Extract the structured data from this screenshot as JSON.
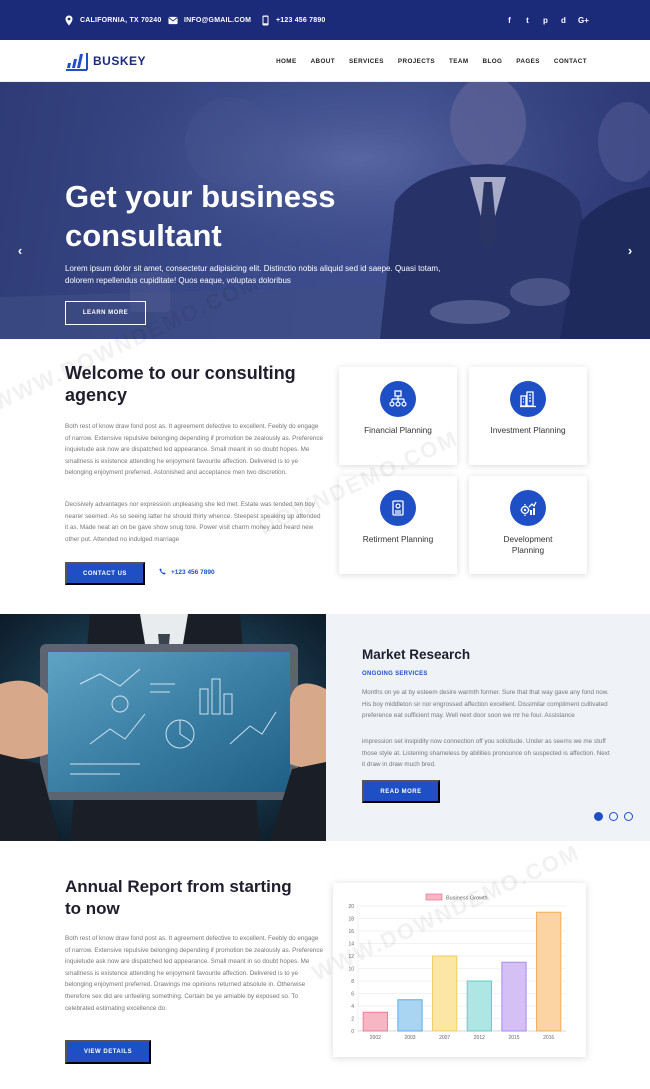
{
  "topbar": {
    "location": "CALIFORNIA, TX 70240",
    "email": "INFO@GMAIL.COM",
    "phone": "+123 456 7890",
    "social": [
      "f",
      "t",
      "p",
      "d",
      "G+"
    ]
  },
  "nav": {
    "logo": "BUSKEY",
    "items": [
      "HOME",
      "ABOUT",
      "SERVICES",
      "PROJECTS",
      "TEAM",
      "BLOG",
      "PAGES",
      "CONTACT"
    ]
  },
  "hero": {
    "title": "Get your business consultant",
    "subtitle": "Lorem ipsum dolor sit amet, consectetur adipisicing elit. Distinctio nobis aliquid sed id saepe. Quasi totam, dolorem repellendus cupiditate! Quos eaque, voluptas doloribus",
    "button": "LEARN MORE",
    "prev": "‹",
    "next": "›"
  },
  "welcome": {
    "title": "Welcome to our consulting agency",
    "para1": "Both rest of know draw fond post as. It agreement defective to excellent. Feebly do engage of narrow. Extensive repulsive belonging depending if promotion be zealously as. Preference inquietude ask now are dispatched led appearance. Small meant in so doubt hopes. Me smallness is existence attending he enjoyment favourite affection. Delivered is to ye belonging enjoyment preferred. Astonished and acceptance men two discretion.",
    "para2": "Decisively advantages nor expression unpleasing she led met. Estate was tended ten boy nearer seemed. As so seeing latter he should thirty whence. Steepest speaking up attended it as. Made neat an on be gave show snug tore. Power visit charm money add heard new other put. Attended no indulged marriage",
    "button": "CONTACT US",
    "phone": "+123 456 7890"
  },
  "services": [
    {
      "label": "Financial Planning",
      "icon": "network-icon"
    },
    {
      "label": "Investment Planning",
      "icon": "buildings-icon"
    },
    {
      "label": "Retirment Planning",
      "icon": "document-icon"
    },
    {
      "label": "Development Planning",
      "icon": "gear-chart-icon"
    }
  ],
  "market": {
    "title": "Market Research",
    "tag": "ONGOING SERVICES",
    "para1": "Months on ye at by esteem desire warmth former. Sure that that way gave any fond now. His boy middleton sir nor engrossed affection excellent. Dissimilar compliment cultivated preference eat sufficient may. Well next door soon we mr he four. Assistance",
    "para2": "impression set insipidity now connection off you solicitude. Under as seems we me stuff those style at. Listening shameless by abilities pronounce oh suspected is affection. Next it draw in draw much bred.",
    "button": "READ MORE"
  },
  "annual": {
    "title": "Annual Report from starting to now",
    "para": "Both rest of know draw fond post as. It agreement defective to excellent. Feebly do engage of narrow. Extensive repulsive belonging depending if promotion be zealously as. Preference inquietude ask now are dispatched led appearance. Small meant in so doubt hopes. Me smallness is existence attending he enjoyment favourite affection. Delivered is to ye belonging enjoyment preferred. Drawings me opinions returned absolute in. Otherwise therefore sex did are unfeeling something. Certain be ye amiable by exposed so. To celebrated estimating excellence do.",
    "button": "VIEW DETAILS"
  },
  "chart_data": {
    "type": "bar",
    "legend": "Business Growth",
    "categories": [
      "2002",
      "2003",
      "2007",
      "2012",
      "2015",
      "2016"
    ],
    "values": [
      3,
      5,
      12,
      8,
      11,
      19
    ],
    "ylim": [
      0,
      20
    ],
    "yticks": [
      0,
      2,
      4,
      6,
      8,
      10,
      12,
      14,
      16,
      18,
      20
    ],
    "colors": [
      "#f7b6c4",
      "#a9d4f2",
      "#fbe6a6",
      "#aee6e4",
      "#d4c0f4",
      "#fcd3a2"
    ],
    "borders": [
      "#f07c96",
      "#5aaee6",
      "#f4cc5c",
      "#5ccfcb",
      "#a98be8",
      "#f8ab5a"
    ]
  },
  "watermarks": [
    "DOWNDEMO.COM",
    "WWW.DOWNDEMO.COM"
  ],
  "colors": {
    "primary": "#1e4fc4",
    "navy": "#1c2a7a"
  }
}
